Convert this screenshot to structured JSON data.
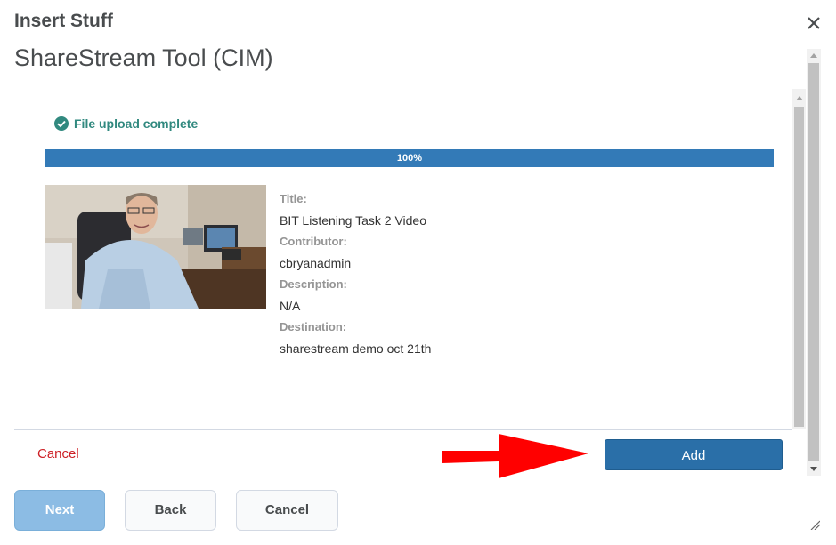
{
  "dialog": {
    "title": "Insert Stuff",
    "tool_title": "ShareStream Tool (CIM)",
    "close_icon": "close-icon"
  },
  "upload": {
    "status_icon": "check-circle-icon",
    "status_text": "File upload complete",
    "progress_percent": 100,
    "progress_label": "100%",
    "status_color": "#31897f",
    "progress_color": "#337ab7"
  },
  "media": {
    "thumbnail": "video-thumbnail-man-at-desk",
    "fields": [
      {
        "label": "Title:",
        "value": "BIT Listening Task 2 Video"
      },
      {
        "label": "Contributor:",
        "value": "cbryanadmin"
      },
      {
        "label": "Description:",
        "value": "N/A"
      },
      {
        "label": "Destination:",
        "value": "sharestream demo oct 21th"
      }
    ]
  },
  "inner_actions": {
    "cancel_label": "Cancel",
    "add_label": "Add",
    "arrow": "red-arrow-pointing-right",
    "add_color": "#2a6fa8",
    "cancel_color": "#cd2026"
  },
  "footer": {
    "next_label": "Next",
    "back_label": "Back",
    "cancel_label": "Cancel",
    "resize_icon": "resize-grip-icon"
  }
}
